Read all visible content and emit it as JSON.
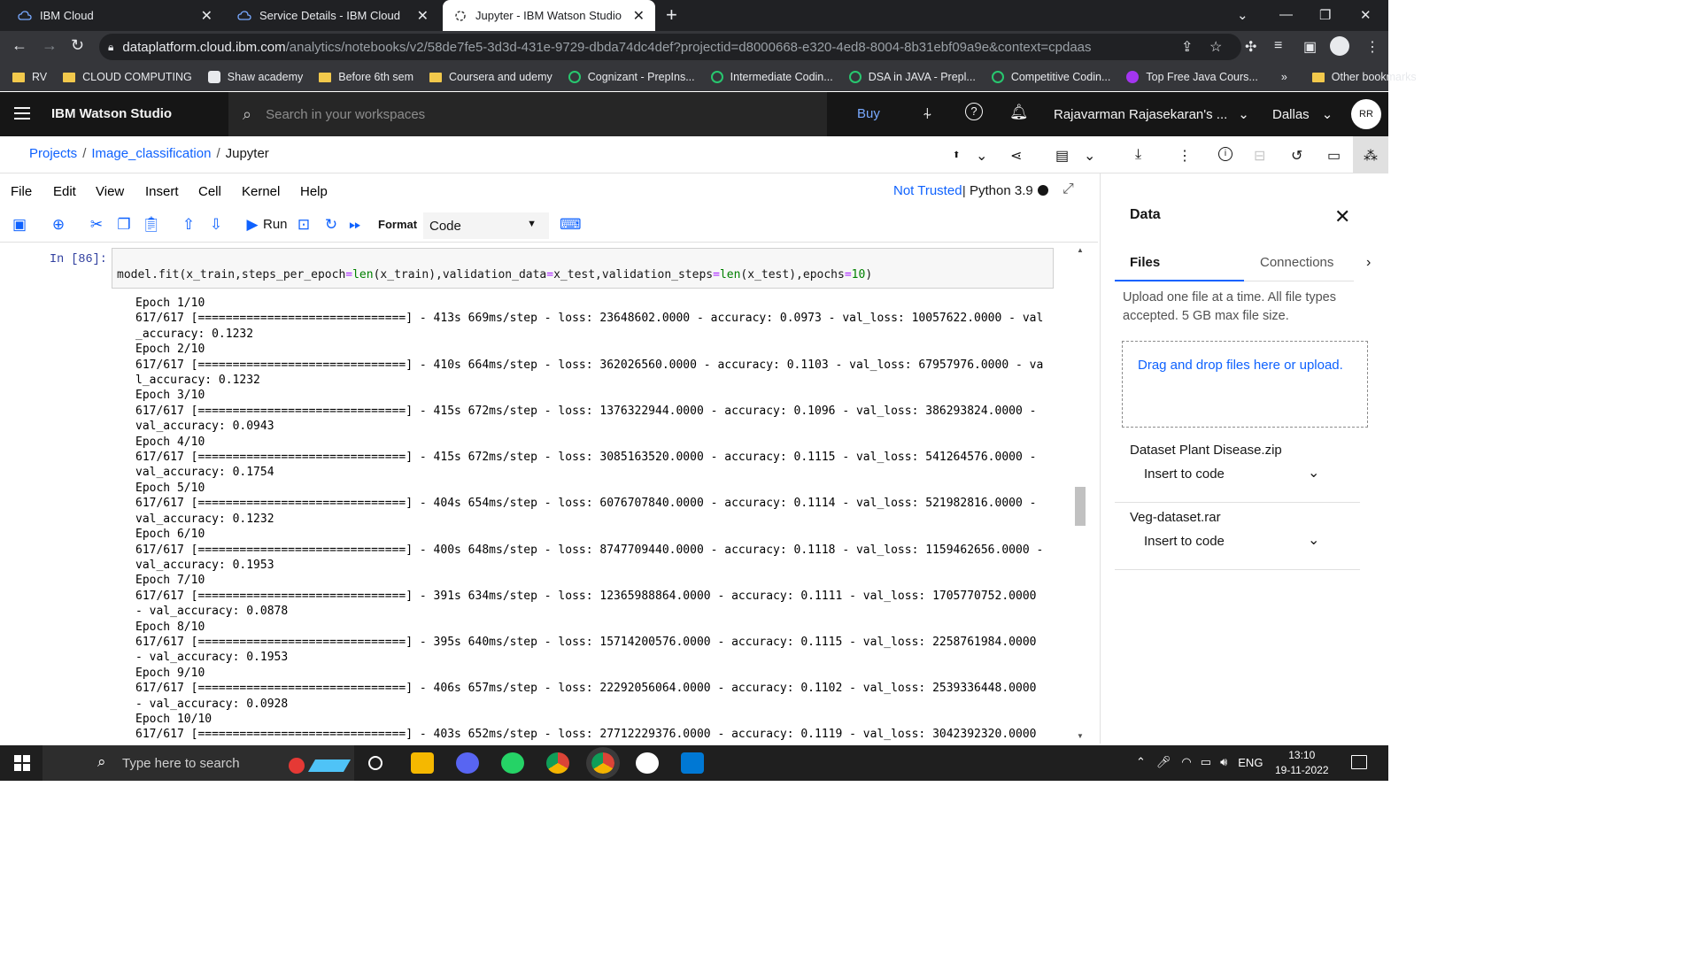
{
  "browser": {
    "tabs": [
      {
        "title": "IBM Cloud"
      },
      {
        "title": "Service Details - IBM Cloud"
      },
      {
        "title": "Jupyter - IBM Watson Studio"
      }
    ],
    "url_domain": "dataplatform.cloud.ibm.com",
    "url_path": "/analytics/notebooks/v2/58de7fe5-3d3d-431e-9729-dbda74dc4def?projectid=d8000668-e320-4ed8-8004-8b31ebf09a9e&context=cpdaas",
    "bookmarks": [
      {
        "label": "RV",
        "icon": "folder"
      },
      {
        "label": "CLOUD COMPUTING",
        "icon": "folder"
      },
      {
        "label": "Shaw academy",
        "icon": "site"
      },
      {
        "label": "Before 6th sem",
        "icon": "folder"
      },
      {
        "label": "Coursera and udemy",
        "icon": "folder"
      },
      {
        "label": "Cognizant - PrepIns...",
        "icon": "prepinsta"
      },
      {
        "label": "Intermediate Codin...",
        "icon": "prepinsta"
      },
      {
        "label": "DSA in JAVA - Prepl...",
        "icon": "prepinsta"
      },
      {
        "label": "Competitive Codin...",
        "icon": "prepinsta"
      },
      {
        "label": "Top Free Java Cours...",
        "icon": "udemy"
      }
    ],
    "overflow": "»",
    "other_bookmarks": "Other bookmarks"
  },
  "header": {
    "brand": "IBM Watson Studio",
    "search_placeholder": "Search in your workspaces",
    "buy": "Buy",
    "account": "Rajavarman Rajasekaran's ...",
    "region": "Dallas",
    "avatar": "RR"
  },
  "breadcrumb": {
    "items": [
      "Projects",
      "Image_classification",
      "Jupyter"
    ]
  },
  "jupyter": {
    "menu": [
      "File",
      "Edit",
      "View",
      "Insert",
      "Cell",
      "Kernel",
      "Help"
    ],
    "trust": "Not Trusted",
    "kernel": "Python 3.9",
    "run": "Run",
    "format_label": "Format",
    "cell_type": "Code",
    "prompt": "In [86]:",
    "code": "model.fit(x_train,steps_per_epoch=len(x_train),validation_data=x_test,validation_steps=len(x_test),epochs=10)",
    "output": [
      "Epoch 1/10",
      "617/617 [==============================] - 413s 669ms/step - loss: 23648602.0000 - accuracy: 0.0973 - val_loss: 10057622.0000 - val",
      "_accuracy: 0.1232",
      "Epoch 2/10",
      "617/617 [==============================] - 410s 664ms/step - loss: 362026560.0000 - accuracy: 0.1103 - val_loss: 67957976.0000 - va",
      "l_accuracy: 0.1232",
      "Epoch 3/10",
      "617/617 [==============================] - 415s 672ms/step - loss: 1376322944.0000 - accuracy: 0.1096 - val_loss: 386293824.0000 -",
      "val_accuracy: 0.0943",
      "Epoch 4/10",
      "617/617 [==============================] - 415s 672ms/step - loss: 3085163520.0000 - accuracy: 0.1115 - val_loss: 541264576.0000 -",
      "val_accuracy: 0.1754",
      "Epoch 5/10",
      "617/617 [==============================] - 404s 654ms/step - loss: 6076707840.0000 - accuracy: 0.1114 - val_loss: 521982816.0000 -",
      "val_accuracy: 0.1232",
      "Epoch 6/10",
      "617/617 [==============================] - 400s 648ms/step - loss: 8747709440.0000 - accuracy: 0.1118 - val_loss: 1159462656.0000 -",
      "val_accuracy: 0.1953",
      "Epoch 7/10",
      "617/617 [==============================] - 391s 634ms/step - loss: 12365988864.0000 - accuracy: 0.1111 - val_loss: 1705770752.0000",
      "- val_accuracy: 0.0878",
      "Epoch 8/10",
      "617/617 [==============================] - 395s 640ms/step - loss: 15714200576.0000 - accuracy: 0.1115 - val_loss: 2258761984.0000",
      "- val_accuracy: 0.1953",
      "Epoch 9/10",
      "617/617 [==============================] - 406s 657ms/step - loss: 22292056064.0000 - accuracy: 0.1102 - val_loss: 2539336448.0000",
      "- val_accuracy: 0.0928",
      "Epoch 10/10",
      "617/617 [==============================] - 403s 652ms/step - loss: 27712229376.0000 - accuracy: 0.1119 - val_loss: 3042392320.0000"
    ]
  },
  "data_panel": {
    "title": "Data",
    "tab_files": "Files",
    "tab_connections": "Connections",
    "info": "Upload one file at a time. All file types accepted. 5 GB max file size.",
    "drop": "Drag and drop files here or upload.",
    "files": [
      {
        "name": "Dataset Plant Disease.zip",
        "action": "Insert to code"
      },
      {
        "name": "Veg-dataset.rar",
        "action": "Insert to code"
      }
    ]
  },
  "taskbar": {
    "search_placeholder": "Type here to search",
    "language": "ENG",
    "time": "13:10",
    "date": "19-11-2022"
  },
  "colors": {
    "ibm_blue": "#0f62fe",
    "header_bg": "#161616",
    "chrome_bg": "#202124"
  }
}
